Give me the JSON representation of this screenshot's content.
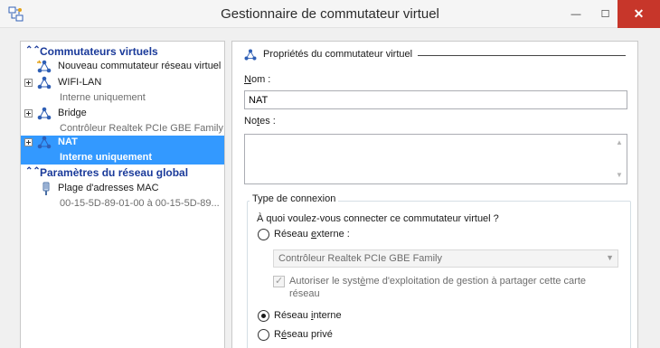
{
  "window": {
    "title": "Gestionnaire de commutateur virtuel",
    "minimize": "—",
    "maximize": "☐",
    "close": "✕"
  },
  "tree": {
    "virtual_switches_header": "Commutateurs virtuels",
    "new_switch": "Nouveau commutateur réseau virtuel",
    "switches": [
      {
        "name": "WIFI-LAN",
        "type": "Interne uniquement"
      },
      {
        "name": "Bridge",
        "type": "Contrôleur Realtek PCIe GBE Family"
      },
      {
        "name": "NAT",
        "type": "Interne uniquement"
      }
    ],
    "global_header": "Paramètres du réseau global",
    "mac_range": {
      "name": "Plage d'adresses MAC",
      "value": "00-15-5D-89-01-00 à 00-15-5D-89..."
    }
  },
  "properties": {
    "header": "Propriétés du commutateur virtuel",
    "name_label_pre": "",
    "name_label_u": "N",
    "name_label_post": "om :",
    "name_value": "NAT",
    "notes_label_pre": "No",
    "notes_label_u": "t",
    "notes_label_post": "es :",
    "connection_type": "Type de connexion",
    "question": "À quoi voulez-vous connecter ce commutateur virtuel ?",
    "external_pre": "Réseau ",
    "external_u": "e",
    "external_post": "xterne :",
    "adapter": "Contrôleur Realtek PCIe GBE Family",
    "allow_mgmt_pre": "Autoriser le syst",
    "allow_mgmt_u": "è",
    "allow_mgmt_post": "me d'exploitation de gestion à partager cette carte réseau",
    "internal_pre": "Réseau ",
    "internal_u": "i",
    "internal_post": "nterne",
    "private_pre": "R",
    "private_u": "é",
    "private_post": "seau privé",
    "selected": "internal"
  },
  "colors": {
    "selection": "#3399ff",
    "section_header": "#1a3a9a",
    "close_button": "#c7362a"
  }
}
